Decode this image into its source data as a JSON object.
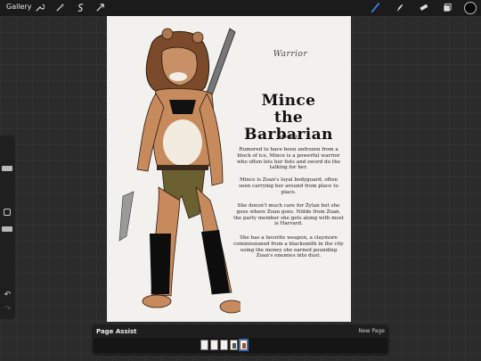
{
  "topbar": {
    "gallery_label": "Gallery",
    "tools": [
      "wrench-icon",
      "magic-wand-icon",
      "selection-icon",
      "transform-icon"
    ],
    "right_tools": [
      "brush-icon",
      "smudge-icon",
      "eraser-icon",
      "layers-icon"
    ],
    "current_color": "#050505",
    "accent": "#2f6ee0"
  },
  "canvas": {
    "character_class": "Warrior",
    "title_line1": "Mince",
    "title_line2": "the Barbarian",
    "pronouns": "(she/her)",
    "paragraphs": [
      "Rumored to have been unfrozen from a block of ice, Mince is a powerful warrior who often lets her fists and sword do the talking for her.",
      "Mince is Zoan's loyal bodyguard, often seen carrying her around from place to place.",
      "She doesn't much care for Zylan but she goes where Zoan goes. Nölde from Zoan, the party member she gets along with most is Harvard.",
      "She has a favorite weapon, a claymore commissioned from a blacksmith in the city using the money she earned pounding Zoan's enemies into dust."
    ]
  },
  "page_assist": {
    "title": "Page Assist",
    "new_page_label": "New Page",
    "page_count": 5,
    "active_page": 5
  },
  "sidebar": {
    "undo_icon": "undo-icon",
    "redo_icon": "redo-icon"
  }
}
